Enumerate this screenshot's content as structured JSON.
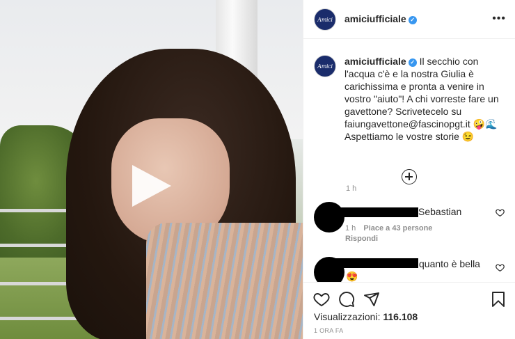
{
  "account": {
    "username": "amiciufficiale",
    "avatar_text": "Amici",
    "verified_icon": "verified-badge-icon"
  },
  "header": {
    "more_label": "•••"
  },
  "caption": {
    "username": "amiciufficiale",
    "text": "Il secchio con l'acqua c'è e la nostra Giulia è carichissima e pronta a venire in vostro \"aiuto\"! A chi vorreste fare un gavettone? Scrivetecelo su faiungavettone@fascinopgt.it 🤪🌊 Aspettiamo le vostre storie 😉",
    "time": "1 h"
  },
  "comments": [
    {
      "text": "Sebastian",
      "time": "1 h",
      "likes": "Piace a 43 persone",
      "reply": "Rispondi"
    },
    {
      "text": "quanto è bella",
      "second_line": "😍"
    }
  ],
  "footer": {
    "views_label": "Visualizzazioni:",
    "views_count": "116.108",
    "post_time": "1 ORA FA"
  },
  "colors": {
    "verified": "#3897f0",
    "avatar_bg": "#1a2c6b",
    "text": "#262626",
    "muted": "#8e8e8e"
  }
}
